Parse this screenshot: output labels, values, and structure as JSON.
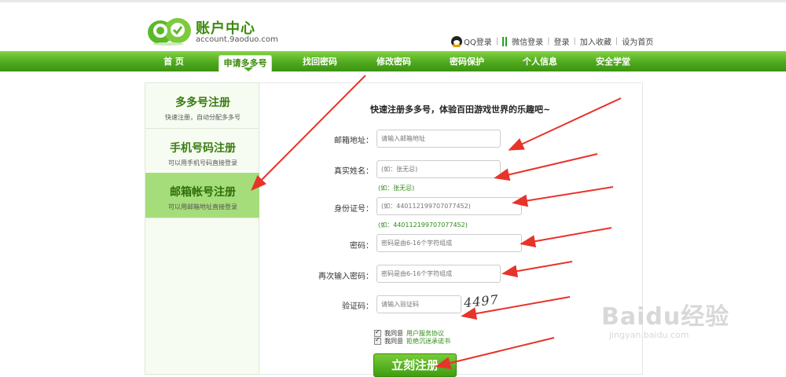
{
  "header": {
    "title": "账户中心",
    "subtitle": "account.9aoduo.com",
    "links": [
      "QQ登录",
      "微信登录",
      "登录",
      "加入收藏",
      "设为首页"
    ]
  },
  "nav": {
    "items": [
      "首 页",
      "申请多多号",
      "找回密码",
      "修改密码",
      "密码保护",
      "个人信息",
      "安全学堂"
    ],
    "active": "申请多多号"
  },
  "sidebar": {
    "items": [
      {
        "title": "多多号注册",
        "sub": "快速注册，自动分配多多号"
      },
      {
        "title": "手机号码注册",
        "sub": "可以用手机号码直接登录"
      },
      {
        "title": "邮箱帐号注册",
        "sub": "可以用邮箱地址直接登录"
      }
    ]
  },
  "form": {
    "slogan": "快速注册多多号，体验百田游戏世界的乐趣吧~",
    "email": {
      "label": "邮箱地址：",
      "placeholder": "请输入邮箱地址"
    },
    "realname": {
      "label": "真实姓名：",
      "placeholder": "(如：张无忌)",
      "hint": "(如：张无忌)"
    },
    "idcard": {
      "label": "身份证号：",
      "placeholder": "(如：440112199707077452)",
      "hint": "(如：440112199707077452)"
    },
    "password": {
      "label": "密码：",
      "placeholder": "密码是由6-16个字符组成"
    },
    "password2": {
      "label": "再次输入密码：",
      "placeholder": "密码是由6-16个字符组成"
    },
    "captcha": {
      "label": "验证码：",
      "placeholder": "请输入验证码",
      "image_text": "4497"
    },
    "agree1": {
      "text": "我同意",
      "link": "用户服务协议"
    },
    "agree2": {
      "text": "我同意",
      "link": "拒绝沉迷承诺书"
    },
    "submit": "立刻注册"
  },
  "watermark": {
    "main": "Baidu经验",
    "sub": "jingyan.baidu.com"
  },
  "colors": {
    "brand_green": "#4fa81e",
    "arrow_red": "#e8332a",
    "hint_green": "#2e8b17"
  }
}
